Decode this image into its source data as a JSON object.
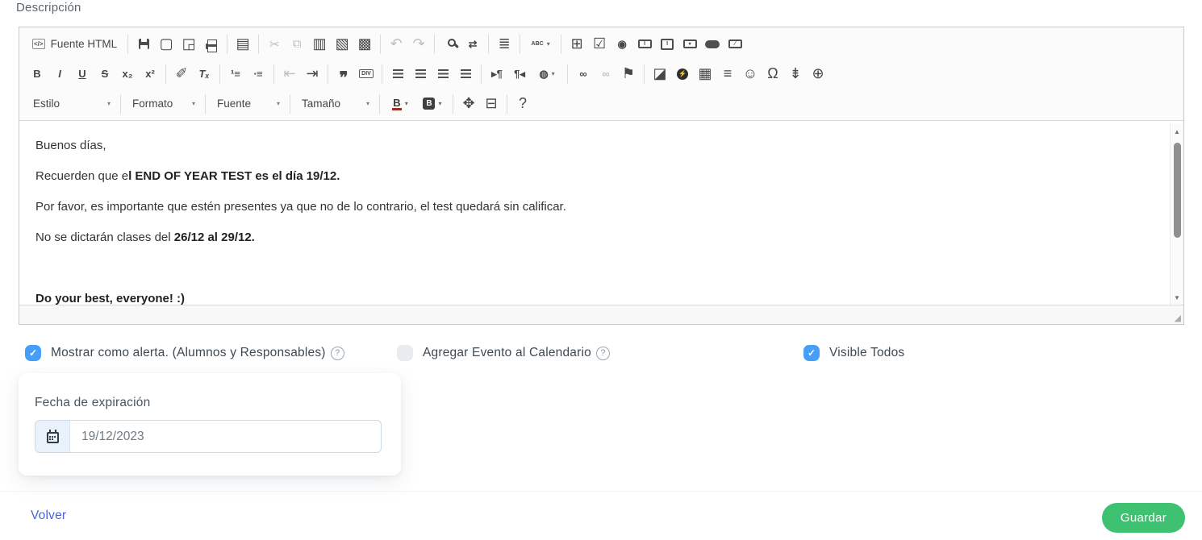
{
  "header": {
    "label": "Descripción"
  },
  "toolbar": {
    "source_label": "Fuente HTML",
    "dropdowns": {
      "style": "Estilo",
      "format": "Formato",
      "font": "Fuente",
      "size": "Tamaño"
    }
  },
  "icons": {
    "source": "</>",
    "new_page": "▢",
    "preview": "◲",
    "templates": "▤",
    "cut": "✂",
    "copy": "⧉",
    "paste": "▥",
    "paste_text": "▧",
    "paste_word": "▩",
    "undo": "↶",
    "redo": "↷",
    "replace": "⇄",
    "select_all": "≣",
    "spell": "ABC",
    "form": "⊞",
    "checkbox": "☑",
    "radio": "◉",
    "bold": "B",
    "italic": "I",
    "underline": "U",
    "strike": "S",
    "subscript": "x₂",
    "superscript": "x²",
    "copy_format": "✐",
    "remove_format": "Tₓ",
    "numbered_list": "¹≡",
    "bulleted_list": "∙≡",
    "outdent": "⇤",
    "indent": "⇥",
    "blockquote": "❞",
    "div": "DIV",
    "bidi_ltr": "▸¶",
    "bidi_rtl": "¶◂",
    "language": "◍",
    "link": "∞",
    "unlink": "∞",
    "anchor": "⚑",
    "image": "◪",
    "flash": "⚡",
    "table": "▦",
    "horizontal_rule": "≡",
    "smiley": "☺",
    "special_char": "Ω",
    "page_break": "⇟",
    "iframe": "⊕",
    "maximize": "✥",
    "show_blocks": "⊟",
    "about": "?",
    "caret": "▾",
    "scroll_up": "▲",
    "scroll_down": "▼",
    "resize_handle": "◢",
    "check": "✓",
    "help": "?"
  },
  "editor": {
    "paragraphs": [
      {
        "text": "Buenos días,"
      },
      {
        "text": "Recuerden que e",
        "bold": "l END OF YEAR TEST es el día 19/12."
      },
      {
        "text": "Por favor, es importante que estén presentes ya que no de lo contrario, el test quedará sin calificar."
      },
      {
        "text": "No se dictarán clases del ",
        "bold": "26/12 al 29/12."
      },
      {
        "text": ""
      },
      {
        "bold": "Do your best, everyone! :)"
      }
    ]
  },
  "options": [
    {
      "label": "Mostrar como alerta. (Alumnos y Responsables)",
      "checked": true,
      "has_help": true
    },
    {
      "label": "Agregar Evento al Calendario",
      "checked": false,
      "has_help": true
    },
    {
      "label": "Visible Todos",
      "checked": true,
      "has_help": false
    }
  ],
  "expiration": {
    "label": "Fecha de expiración",
    "value": "19/12/2023"
  },
  "actions": {
    "back": "Volver",
    "save": "Guardar"
  },
  "colors": {
    "checkbox_blue": "#459EF7",
    "link_blue": "#4A63DD",
    "save_green": "#3EC272",
    "addon_blue": "#E9F2FB"
  }
}
